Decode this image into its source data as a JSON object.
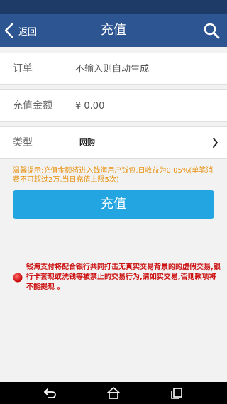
{
  "header": {
    "back_label": "返回",
    "title": "充值",
    "bar_color": "#2c5591",
    "icons": {
      "back": "chevron-left-icon",
      "search": "search-icon"
    }
  },
  "form": {
    "order": {
      "label": "订单",
      "placeholder": "不输入则自动生成",
      "value": ""
    },
    "amount": {
      "label": "充值金额",
      "placeholder": "¥ 0.00",
      "value": ""
    },
    "type": {
      "label": "类型",
      "value": "网购"
    }
  },
  "tip": "温馨提示:充值金额将进入钱海用户钱包,日收益为0.05%(单笔消费不可超过2万,当日充值上限5次)",
  "submit_label": "充值",
  "submit_color": "#22a5e0",
  "warning": "钱海支付将配合银行共同打击无真实交易背景的的虚假交易,银行卡套现或洗钱等被禁止的交易行为,请如实交易,否则款项将不能提现 。",
  "warning_color": "#cc1111",
  "nav": {
    "icons": [
      "back-arrow-icon",
      "home-icon",
      "recents-icon"
    ]
  }
}
